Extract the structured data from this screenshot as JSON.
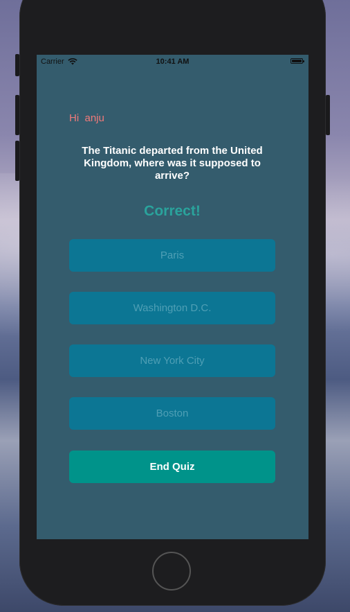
{
  "status_bar": {
    "carrier": "Carrier",
    "time": "10:41 AM",
    "wifi_icon": "wifi-icon",
    "battery_icon": "battery-icon"
  },
  "quiz": {
    "greeting": "Hi  anju",
    "question": "The Titanic departed from the United Kingdom, where was it supposed to arrive?",
    "feedback": "Correct!",
    "answers": [
      "Paris",
      "Washington D.C.",
      "New York City",
      "Boston"
    ],
    "end_button": "End Quiz"
  },
  "colors": {
    "screen_background": "#345c6d",
    "greeting": "#f07a7a",
    "feedback": "#2aa39c",
    "answer_button": "#0c7694",
    "end_button": "#00938a"
  }
}
